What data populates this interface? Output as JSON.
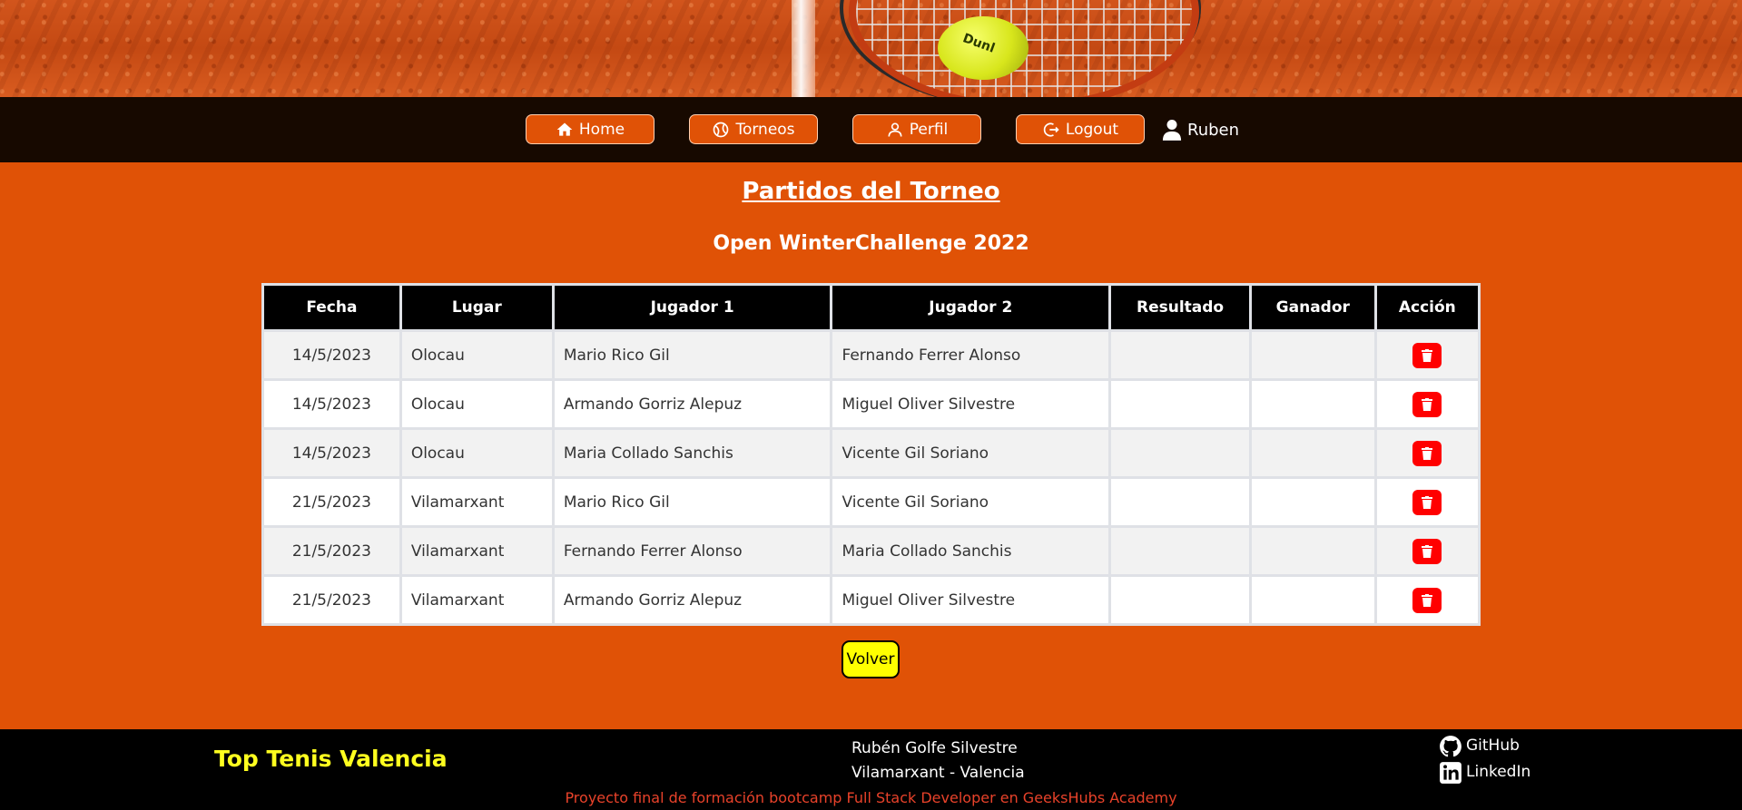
{
  "nav": {
    "home_label": "Home",
    "torneos_label": "Torneos",
    "perfil_label": "Perfil",
    "logout_label": "Logout",
    "user_name": "Ruben"
  },
  "main": {
    "title": "Partidos del Torneo",
    "tournament_name": "Open WinterChallenge 2022",
    "columns": [
      "Fecha",
      "Lugar",
      "Jugador 1",
      "Jugador 2",
      "Resultado",
      "Ganador",
      "Acción"
    ],
    "rows": [
      {
        "fecha": "14/5/2023",
        "lugar": "Olocau",
        "jugador1": "Mario Rico Gil",
        "jugador2": "Fernando Ferrer Alonso",
        "resultado": "",
        "ganador": ""
      },
      {
        "fecha": "14/5/2023",
        "lugar": "Olocau",
        "jugador1": "Armando Gorriz Alepuz",
        "jugador2": "Miguel Oliver Silvestre",
        "resultado": "",
        "ganador": ""
      },
      {
        "fecha": "14/5/2023",
        "lugar": "Olocau",
        "jugador1": "Maria Collado Sanchis",
        "jugador2": "Vicente Gil Soriano",
        "resultado": "",
        "ganador": ""
      },
      {
        "fecha": "21/5/2023",
        "lugar": "Vilamarxant",
        "jugador1": "Mario Rico Gil",
        "jugador2": "Vicente Gil Soriano",
        "resultado": "",
        "ganador": ""
      },
      {
        "fecha": "21/5/2023",
        "lugar": "Vilamarxant",
        "jugador1": "Fernando Ferrer Alonso",
        "jugador2": "Maria Collado Sanchis",
        "resultado": "",
        "ganador": ""
      },
      {
        "fecha": "21/5/2023",
        "lugar": "Vilamarxant",
        "jugador1": "Armando Gorriz Alepuz",
        "jugador2": "Miguel Oliver Silvestre",
        "resultado": "",
        "ganador": ""
      }
    ],
    "back_label": "Volver"
  },
  "footer": {
    "brand": "Top Tenis Valencia",
    "author_name": "Rubén Golfe Silvestre",
    "author_location": "Vilamarxant - Valencia",
    "github_label": "GitHub",
    "linkedin_label": "LinkedIn",
    "credit": "Proyecto final de formación bootcamp Full Stack Developer en GeeksHubs Academy"
  },
  "banner": {
    "ball_text": "Dunl"
  },
  "colors": {
    "accent": "#e05206",
    "nav_bg": "#170900",
    "delete": "#ff0000",
    "back_button": "#ffff00",
    "brand": "#ffff1f"
  }
}
